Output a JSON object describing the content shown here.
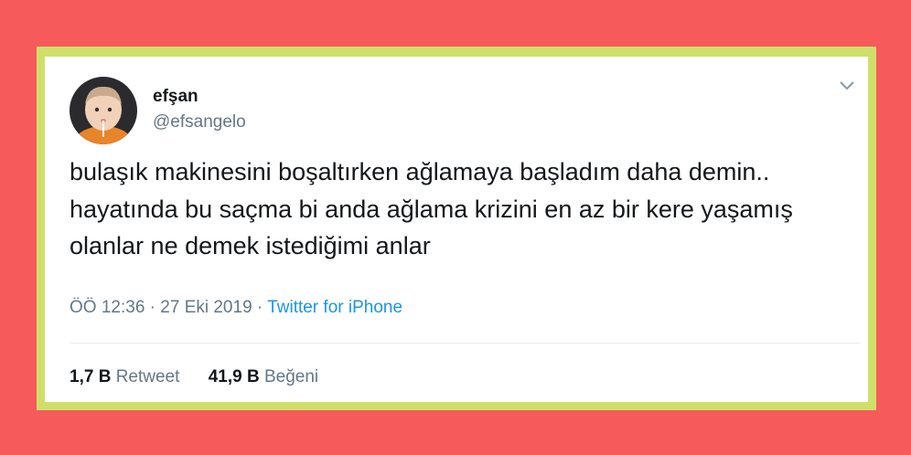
{
  "colors": {
    "page_background": "#f75a5a",
    "frame_border": "#cfe06a",
    "card_background": "#ffffff",
    "link_blue": "#1b95e0",
    "muted_gray": "#657786",
    "text_dark": "#14171a"
  },
  "tweet": {
    "author": {
      "display_name": "efşan",
      "handle": "@efsangelo",
      "avatar_icon": "child-avatar"
    },
    "menu_icon": "chevron-down-icon",
    "text": "bulaşık makinesini boşaltırken ağlamaya başladım daha demin.. hayatında bu saçma bi anda ağlama krizini en az bir kere yaşamış olanlar ne demek istediğimi anlar",
    "time": "ÖÖ 12:36",
    "separator": "·",
    "date": "27 Eki 2019",
    "source": "Twitter for iPhone",
    "retweets": {
      "count": "1,7 B",
      "label": "Retweet"
    },
    "likes": {
      "count": "41,9 B",
      "label": "Beğeni"
    }
  }
}
